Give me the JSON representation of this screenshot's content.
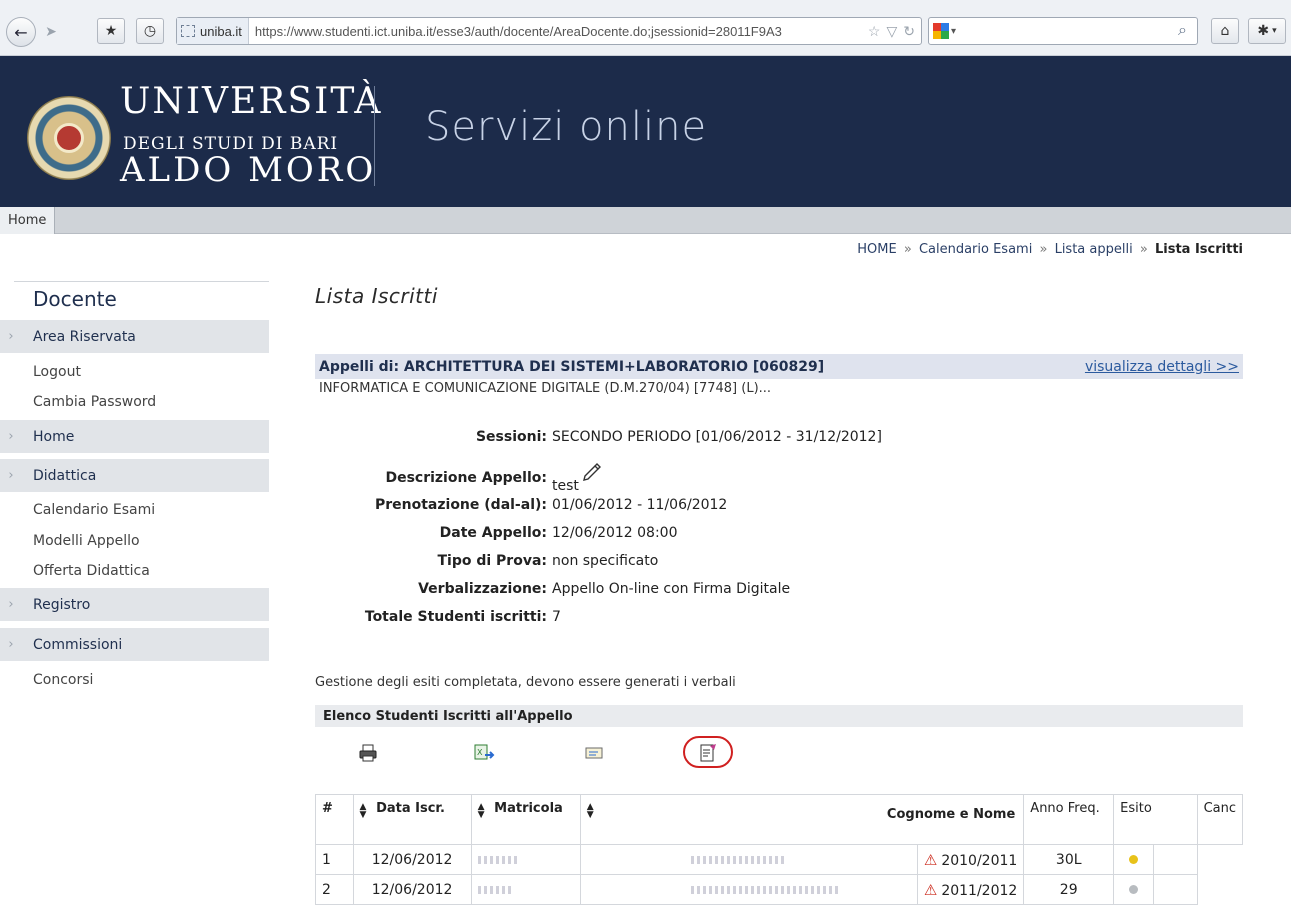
{
  "browser": {
    "site_label": "uniba.it",
    "url": "https://www.studenti.ict.uniba.it/esse3/auth/docente/AreaDocente.do;jsessionid=28011F9A3"
  },
  "banner": {
    "name_line1": "UNIVERSITÀ",
    "name_line2": "DEGLI STUDI DI BARI",
    "name_line3": "ALDO MORO",
    "service_title": "Servizi online"
  },
  "topnav": {
    "home_label": "Home"
  },
  "breadcrumb": {
    "items": [
      "HOME",
      "Calendario Esami",
      "Lista appelli"
    ],
    "separator": "»",
    "current": "Lista Iscritti"
  },
  "sidebar": {
    "title": "Docente",
    "sections": [
      {
        "label": "Area Riservata",
        "links": [
          "Logout",
          "Cambia Password"
        ]
      },
      {
        "label": "Home",
        "links": []
      },
      {
        "label": "Didattica",
        "links": [
          "Calendario Esami",
          "Modelli Appello",
          "Offerta Didattica"
        ]
      },
      {
        "label": "Registro",
        "links": []
      },
      {
        "label": "Commissioni",
        "links": [
          "Concorsi"
        ]
      }
    ]
  },
  "main": {
    "title": "Lista Iscritti",
    "appello_header": "Appelli di: ARCHITETTURA DEI SISTEMI+LABORATORIO [060829]",
    "dettagli_link": "visualizza dettagli >>",
    "corso": "INFORMATICA E COMUNICAZIONE DIGITALE (D.M.270/04) [7748] (L)...",
    "info": [
      {
        "label": "Sessioni:",
        "value": "SECONDO PERIODO [01/06/2012 - 31/12/2012]"
      },
      {
        "label": "Descrizione Appello:",
        "value": "test"
      },
      {
        "label": "Prenotazione (dal-al):",
        "value": "01/06/2012 - 11/06/2012"
      },
      {
        "label": "Date Appello:",
        "value": "12/06/2012 08:00"
      },
      {
        "label": "Tipo di Prova:",
        "value": "non specificato"
      },
      {
        "label": "Verbalizzazione:",
        "value": "Appello On-line con Firma Digitale"
      },
      {
        "label": "Totale Studenti iscritti:",
        "value": "7"
      }
    ],
    "gestione_msg": "Gestione degli esiti completata, devono essere generati i verbali",
    "elenco_title": "Elenco Studenti Iscritti all'Appello",
    "toolbar_icons": [
      "print-icon",
      "excel-export-icon",
      "email-icon",
      "generate-verbale-icon"
    ]
  },
  "table": {
    "headers": {
      "num": "#",
      "data_iscr": "Data Iscr.",
      "matricola": "Matricola",
      "cognome_nome": "Cognome e Nome",
      "anno_freq": "Anno Freq.",
      "esito": "Esito",
      "canc": "Canc"
    },
    "rows": [
      {
        "num": "1",
        "data_iscr": "12/06/2012",
        "anno_freq": "2010/2011",
        "esito": "30L",
        "status_color": "#e8c21a"
      },
      {
        "num": "2",
        "data_iscr": "12/06/2012",
        "anno_freq": "2011/2012",
        "esito": "29",
        "status_color": "#b8bcc0"
      }
    ]
  },
  "colors": {
    "banner_bg": "#1c2b4a",
    "appello_bar": "#dfe3ee",
    "link": "#2b5a9e",
    "highlight_ring": "#d02020"
  }
}
